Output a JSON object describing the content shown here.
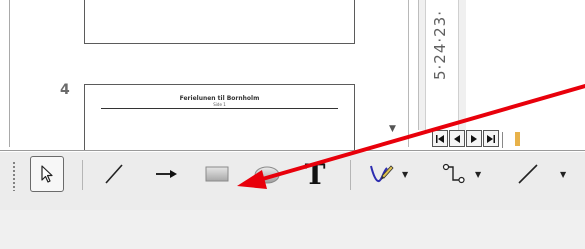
{
  "slide_panel": {
    "slide_number": "4",
    "thumbnail_title": "Ferielunen til Bornholm",
    "thumbnail_subtitle": "Side 1"
  },
  "ruler": {
    "text": "5·24·23·"
  },
  "navigation": {
    "first_icon": "first-icon",
    "prev_icon": "prev-icon",
    "next_icon": "next-icon",
    "last_icon": "last-icon"
  },
  "toolbar": {
    "text_tool_label": "T",
    "tools": [
      "select-icon",
      "line-icon",
      "arrow-line-icon",
      "rectangle-icon",
      "ellipse-icon",
      "text-icon",
      "curve-icon",
      "connector-icon",
      "lines-and-arrows-icon"
    ]
  },
  "colors": {
    "annotation_arrow": "#e8000b",
    "toolbar_bg": "#ececec",
    "status_bg": "#f0f0f0"
  }
}
